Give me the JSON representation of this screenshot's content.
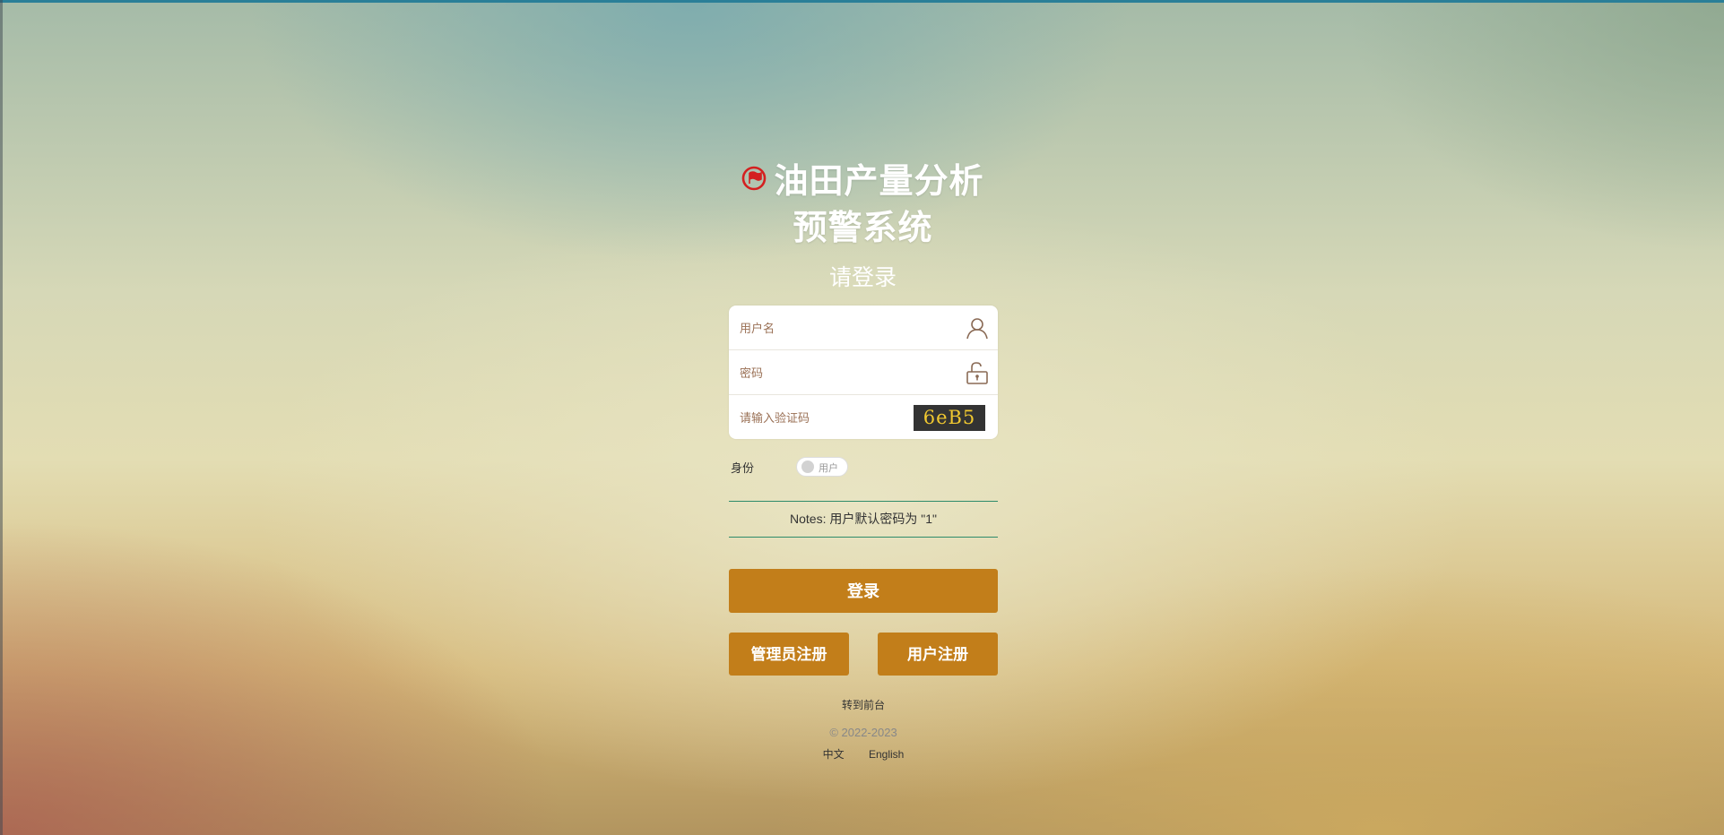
{
  "header": {
    "title_line1": "油田产量分析",
    "title_line2": "预警系统",
    "subtitle": "请登录",
    "logo_icon": "red-flag-icon"
  },
  "form": {
    "username_placeholder": "用户名",
    "password_placeholder": "密码",
    "captcha_placeholder": "请输入验证码",
    "captcha_text": "6eB5",
    "username_icon": "user-icon",
    "password_icon": "unlock-icon"
  },
  "role": {
    "label": "身份",
    "toggle_label": "用户"
  },
  "notes": "Notes: 用户默认密码为 \"1\"",
  "buttons": {
    "login": "登录",
    "admin_register": "管理员注册",
    "user_register": "用户注册"
  },
  "footer": {
    "front_link": "转到前台",
    "copyright": "© 2022-2023",
    "lang_zh": "中文",
    "lang_en": "English"
  },
  "colors": {
    "button": "#c27e1a",
    "notes_border": "#2e8b6a",
    "captcha_bg": "#333333",
    "captcha_text": "#f0c830",
    "logo": "#d42020"
  }
}
